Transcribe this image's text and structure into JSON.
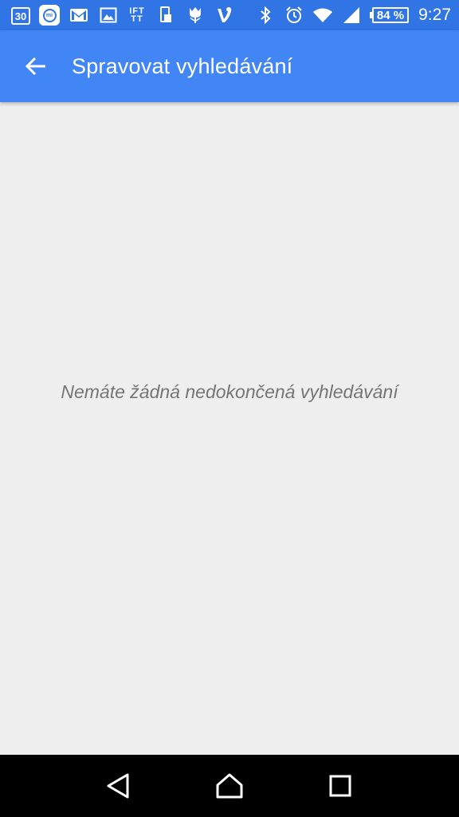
{
  "status_bar": {
    "calendar_date": "30",
    "mi_label": "mi",
    "ifttt_label_top": "IFT",
    "ifttt_label_bottom": "TT",
    "battery_percent": "84 %",
    "time": "9:27"
  },
  "app_bar": {
    "title": "Spravovat vyhledávání",
    "color": "#4285f4"
  },
  "content": {
    "empty_message": "Nemáte žádná nedokončená vyhledávání"
  },
  "icons": {
    "left": [
      "calendar-icon",
      "mi-fit-icon",
      "gmail-icon",
      "gallery-icon",
      "ifttt-icon",
      "phone-icon",
      "tulip-icon",
      "vine-icon"
    ],
    "right": [
      "bluetooth-icon",
      "alarm-icon",
      "wifi-icon",
      "signal-icon",
      "battery-icon"
    ]
  }
}
